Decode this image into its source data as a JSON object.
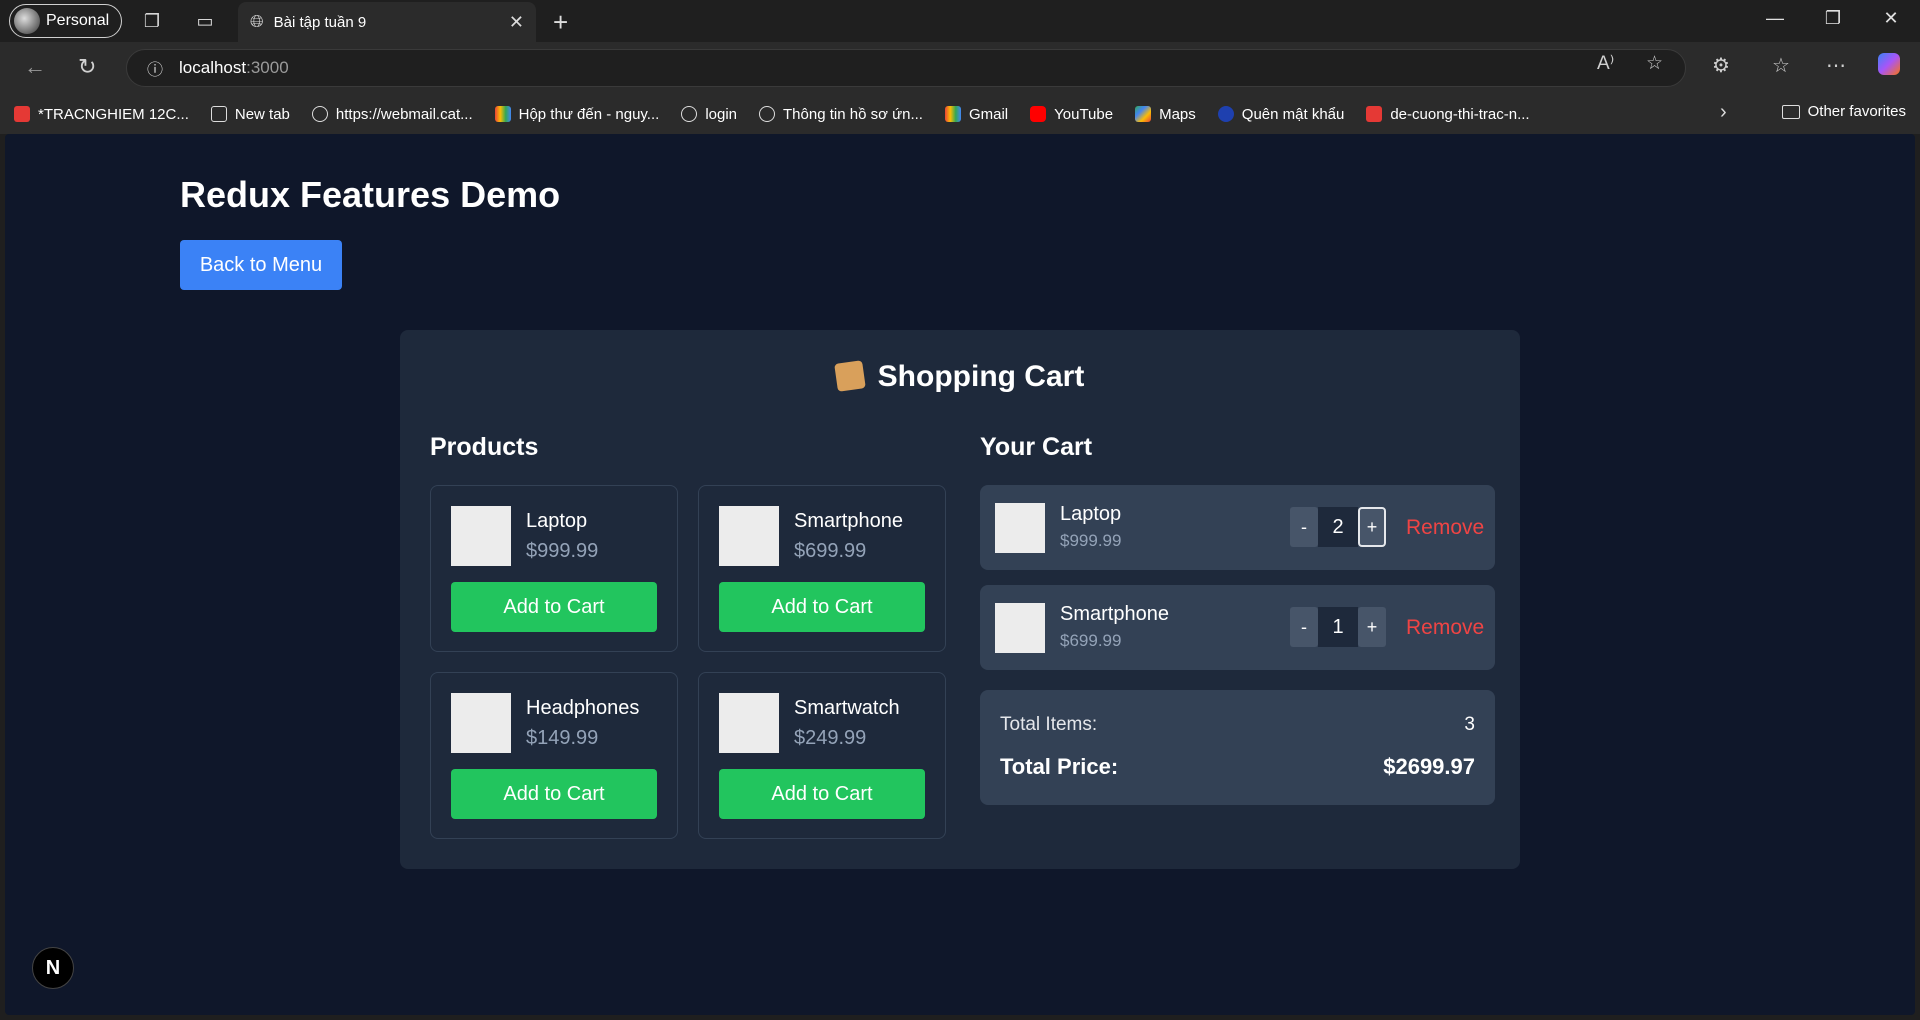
{
  "browser": {
    "profile_label": "Personal",
    "tab_title": "Bài tập tuần 9",
    "address_host": "localhost",
    "address_port": ":3000",
    "bookmarks": [
      {
        "label": "*TRACNGHIEM 12C...",
        "icon": "pdf-icon"
      },
      {
        "label": "New tab",
        "icon": "newtab-icon"
      },
      {
        "label": "https://webmail.cat...",
        "icon": "globe-icon"
      },
      {
        "label": "Hộp thư đến - nguy...",
        "icon": "gmail-icon"
      },
      {
        "label": "login",
        "icon": "globe-icon"
      },
      {
        "label": "Thông tin hồ sơ ứn...",
        "icon": "globe-icon"
      },
      {
        "label": "Gmail",
        "icon": "gmail-icon"
      },
      {
        "label": "YouTube",
        "icon": "youtube-icon"
      },
      {
        "label": "Maps",
        "icon": "maps-icon"
      },
      {
        "label": "Quên mật khẩu",
        "icon": "site-icon"
      },
      {
        "label": "de-cuong-thi-trac-n...",
        "icon": "pdf-icon"
      }
    ],
    "other_favorites": "Other favorites"
  },
  "page": {
    "title": "Redux Features Demo",
    "back_button": "Back to Menu",
    "cart_title": "Shopping Cart",
    "products_heading": "Products",
    "cart_heading": "Your Cart",
    "products": [
      {
        "name": "Laptop",
        "price": "$999.99",
        "button": "Add to Cart"
      },
      {
        "name": "Smartphone",
        "price": "$699.99",
        "button": "Add to Cart"
      },
      {
        "name": "Headphones",
        "price": "$149.99",
        "button": "Add to Cart"
      },
      {
        "name": "Smartwatch",
        "price": "$249.99",
        "button": "Add to Cart"
      }
    ],
    "cart_items": [
      {
        "name": "Laptop",
        "price": "$999.99",
        "qty": "2",
        "minus": "-",
        "plus": "+",
        "remove": "Remove"
      },
      {
        "name": "Smartphone",
        "price": "$699.99",
        "qty": "1",
        "minus": "-",
        "plus": "+",
        "remove": "Remove"
      }
    ],
    "totals": {
      "items_label": "Total Items:",
      "items_value": "3",
      "price_label": "Total Price:",
      "price_value": "$2699.97"
    },
    "next_badge": "N"
  },
  "colors": {
    "page_bg": "#0f172a",
    "card_bg": "#1e293b",
    "accent_blue": "#3b82f6",
    "accent_green": "#22c55e",
    "remove_red": "#ef4444"
  }
}
